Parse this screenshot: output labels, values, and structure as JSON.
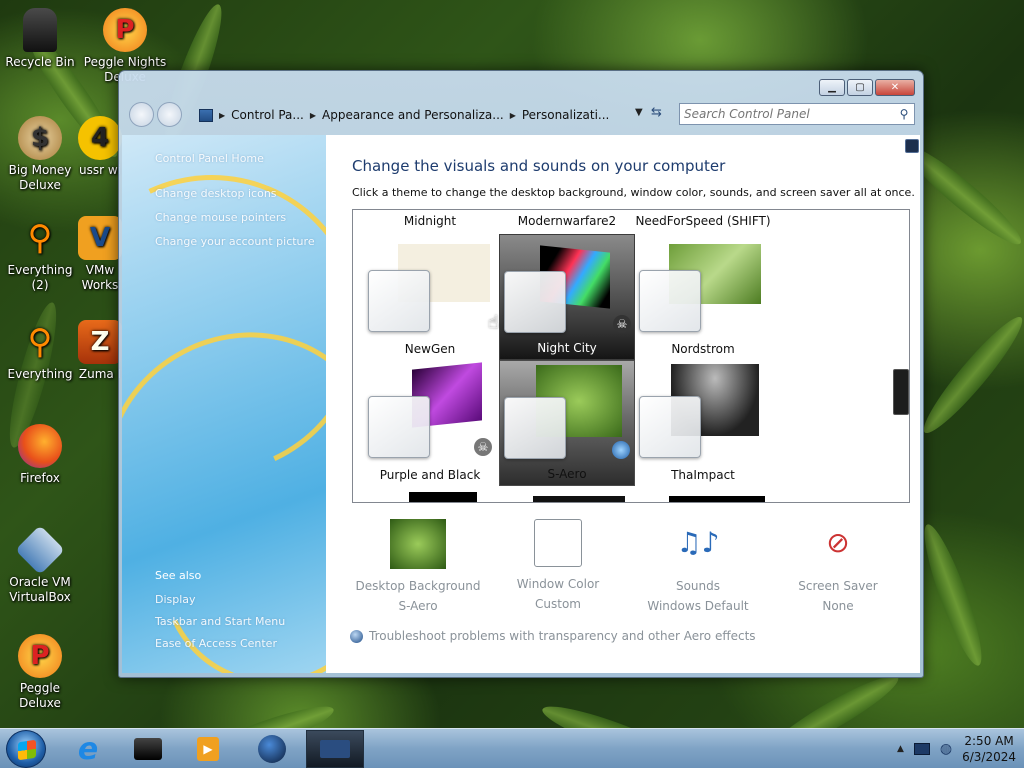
{
  "desktop": {
    "icons": [
      {
        "label": "Recycle Bin"
      },
      {
        "label": "Peggle Nights Deluxe"
      },
      {
        "label": "Big Money Deluxe"
      },
      {
        "label": "ussr wi"
      },
      {
        "label": "Everything (2)"
      },
      {
        "label": "VMw Works"
      },
      {
        "label": "Everything"
      },
      {
        "label": "Zuma I"
      },
      {
        "label": "Firefox"
      },
      {
        "label": "Oracle VM VirtualBox"
      },
      {
        "label": "Peggle Deluxe"
      }
    ]
  },
  "window": {
    "breadcrumb": [
      "Control Pa...",
      "Appearance and Personaliza...",
      "Personalizati..."
    ],
    "search_placeholder": "Search Control Panel",
    "controls": {
      "minimize": "▁",
      "maximize": "▢",
      "close": "✕"
    }
  },
  "sidebar": {
    "home": "Control Panel Home",
    "links": [
      "Change desktop icons",
      "Change mouse pointers",
      "Change your account picture"
    ],
    "see_also": "See also",
    "see_also_links": [
      "Display",
      "Taskbar and Start Menu",
      "Ease of Access Center"
    ]
  },
  "main": {
    "title": "Change the visuals and sounds on your computer",
    "subtitle": "Click a theme to change the desktop background, window color, sounds, and screen saver all at once.",
    "themes_row0": [
      "Midnight",
      "Modernwarfare2",
      "NeedForSpeed (SHIFT)"
    ],
    "themes_row1": [
      "NewGen",
      "Night City",
      "Nordstrom"
    ],
    "themes_row2": [
      "Purple and Black",
      "S-Aero",
      "ThaImpact"
    ]
  },
  "options": [
    {
      "name": "Desktop Background",
      "value": "S-Aero",
      "icon": "desktop-background-icon"
    },
    {
      "name": "Window Color",
      "value": "Custom",
      "icon": "window-color-icon"
    },
    {
      "name": "Sounds",
      "value": "Windows Default",
      "icon": "sounds-icon"
    },
    {
      "name": "Screen Saver",
      "value": "None",
      "icon": "screen-saver-icon"
    }
  ],
  "troubleshoot": "Troubleshoot problems with transparency and other Aero effects",
  "taskbar": {
    "time": "2:50 AM",
    "date": "6/3/2024"
  },
  "colors": {
    "title": "#1e3c6e",
    "disabled_text": "#8a9299",
    "taskbar": "#7fa3c5",
    "sidebar": "#4fb0e3"
  }
}
